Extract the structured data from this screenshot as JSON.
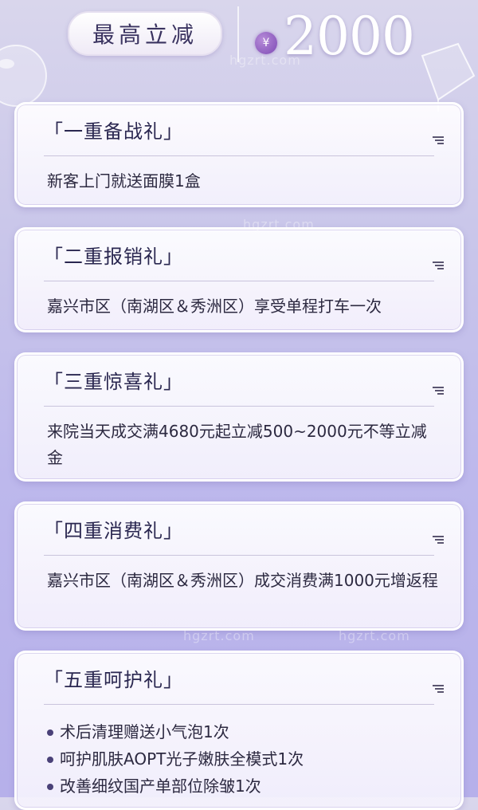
{
  "header": {
    "badge_label": "最高立减",
    "currency_symbol": "¥",
    "amount": "2000"
  },
  "cards": [
    {
      "title": "「一重备战礼」",
      "body": "新客上门就送面膜1盒"
    },
    {
      "title": "「二重报销礼」",
      "body": "嘉兴市区（南湖区＆秀洲区）享受单程打车一次"
    },
    {
      "title": "「三重惊喜礼」",
      "body": "来院当天成交满4680元起立减500~2000元不等立减金"
    },
    {
      "title": "「四重消费礼」",
      "body": "嘉兴市区（南湖区＆秀洲区）成交消费满1000元增返程"
    },
    {
      "title": "「五重呵护礼」",
      "bullets": [
        "术后清理赠送小气泡1次",
        "呵护肌肤AOPT光子嫩肤全模式1次",
        "改善细纹国产单部位除皱1次"
      ]
    }
  ],
  "watermark": "hgzrt.com"
}
